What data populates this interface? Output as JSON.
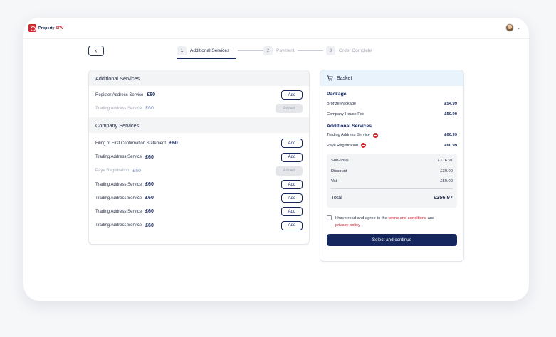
{
  "brand": {
    "name_part1": "Property",
    "name_part2": "SPV"
  },
  "header": {
    "avatar_label": "user avatar"
  },
  "stepper": {
    "steps": [
      {
        "num": "1",
        "label": "Additional Services"
      },
      {
        "num": "2",
        "label": "Payment"
      },
      {
        "num": "3",
        "label": "Order Complete"
      }
    ]
  },
  "services": {
    "additional_title": "Additional Services",
    "additional": [
      {
        "name": "Register Address Service",
        "price": "£60",
        "action": "Add"
      },
      {
        "name": "Trading Address Service",
        "price": "£60",
        "action": "Added"
      }
    ],
    "company_title": "Company Services",
    "company": [
      {
        "name": "Filing of First Confirmation Statement",
        "price": "£60",
        "action": "Add"
      },
      {
        "name": "Trading Address Service",
        "price": "£60",
        "action": "Add"
      },
      {
        "name": "Paye Registration",
        "price": "£60",
        "action": "Added"
      },
      {
        "name": "Trading Address Service",
        "price": "£60",
        "action": "Add"
      },
      {
        "name": "Trading Address Service",
        "price": "£60",
        "action": "Add"
      },
      {
        "name": "Trading Address Service",
        "price": "£60",
        "action": "Add"
      },
      {
        "name": "Trading Address Service",
        "price": "£60",
        "action": "Add"
      }
    ]
  },
  "basket": {
    "title": "Basket",
    "package_title": "Package",
    "package": [
      {
        "name": "Bronze Package",
        "price": "£54.99"
      },
      {
        "name": "Company House Fee",
        "price": "£50.99"
      }
    ],
    "additional_title": "Additional Services",
    "additional": [
      {
        "name": "Trading Address Service",
        "price": "£60.99"
      },
      {
        "name": "Paye Registration",
        "price": "£60.99"
      }
    ],
    "subtotal_label": "Sub-Total",
    "subtotal": "£176.97",
    "discount_label": "Discount",
    "discount": "£30.00",
    "vat_label": "Vat",
    "vat": "£50.00",
    "total_label": "Total",
    "total": "£256.97",
    "agree_prefix": "I have read and agree to the",
    "terms_link": "terms and conditions",
    "agree_and": "and",
    "privacy_link": "privacy policy",
    "cta": "Select and continue"
  },
  "colors": {
    "navy": "#15265e",
    "brand_red": "#d62730",
    "basket_header_bg": "#e8f3fc"
  }
}
